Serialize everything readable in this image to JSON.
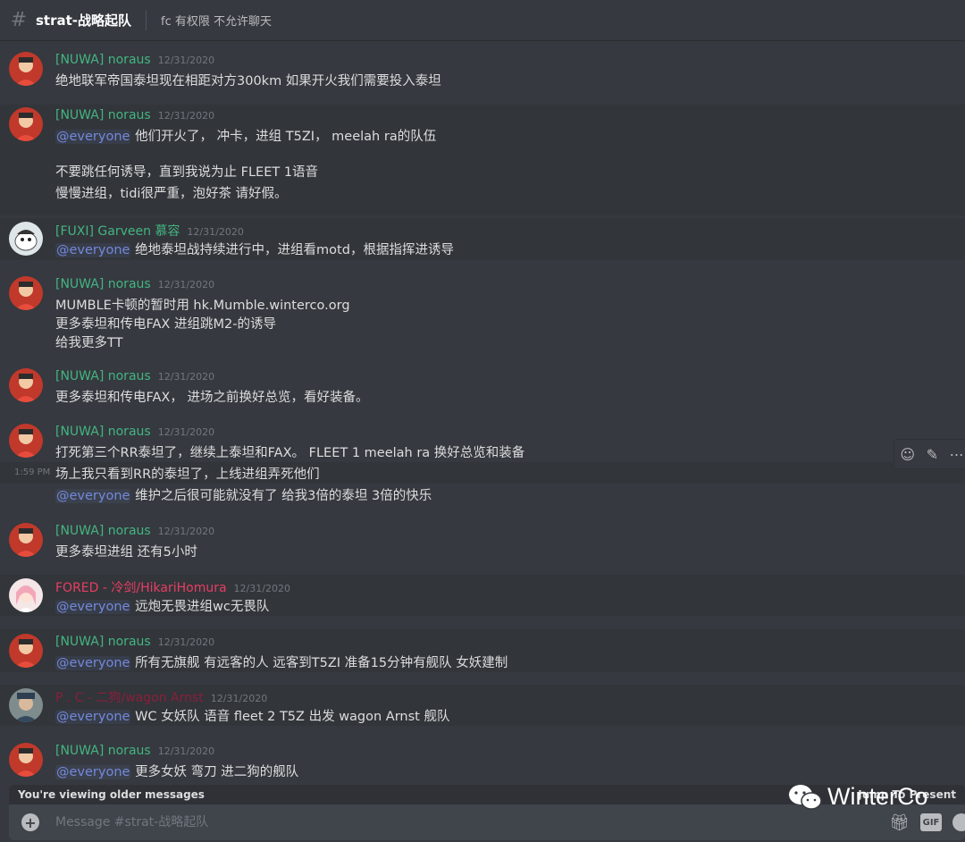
{
  "header": {
    "channel": "strat-战略起队",
    "topic": "fc 有权限 不允许聊天"
  },
  "messages": [
    {
      "author": "[NUWA] noraus",
      "time": "12/31/2020",
      "lines": [
        "绝地联军帝国泰坦现在相距对方300km 如果开火我们需要投入泰坦"
      ]
    },
    {
      "author": "[NUWA] noraus",
      "time": "12/31/2020",
      "mention": "@everyone",
      "lines": [
        "他们开火了， 冲卡，进组 T5ZI， meelah ra的队伍",
        "不要跳任何诱导，直到我说为止 FLEET 1语音",
        "慢慢进组，tidi很严重，泡好茶 请好假。"
      ]
    },
    {
      "author": "[FUXI] Garveen 慕容",
      "time": "12/31/2020",
      "mention": "@everyone",
      "lines": [
        "绝地泰坦战持续进行中，进组看motd，根据指挥进诱导"
      ]
    },
    {
      "author": "[NUWA] noraus",
      "time": "12/31/2020",
      "lines": [
        "MUMBLE卡顿的暂时用 hk.Mumble.winterco.org",
        "更多泰坦和传电FAX 进组跳M2-的诱导",
        "给我更多TT"
      ]
    },
    {
      "author": "[NUWA] noraus",
      "time": "12/31/2020",
      "lines": [
        "更多泰坦和传电FAX， 进场之前换好总览，看好装备。"
      ]
    },
    {
      "author": "[NUWA] noraus",
      "time": "12/31/2020",
      "hover_time": "1:59 PM",
      "mention": "@everyone",
      "lines": [
        "打死第三个RR泰坦了，继续上泰坦和FAX。 FLEET 1 meelah ra  换好总览和装备",
        "场上我只看到RR的泰坦了，上线进组弄死他们",
        "维护之后很可能就没有了 给我3倍的泰坦 3倍的快乐"
      ]
    },
    {
      "author": "[NUWA] noraus",
      "time": "12/31/2020",
      "lines": [
        "更多泰坦进组 还有5小时"
      ]
    },
    {
      "author": "FORED - 冷剑/HikariHomura",
      "time": "12/31/2020",
      "mention": "@everyone",
      "lines": [
        "远炮无畏进组wc无畏队"
      ]
    },
    {
      "author": "[NUWA] noraus",
      "time": "12/31/2020",
      "mention": "@everyone",
      "lines": [
        "所有无旗舰 有远客的人 远客到T5ZI 准备15分钟有舰队 女妖建制"
      ]
    },
    {
      "author": "P . C - 二狗/wagon Arnst",
      "time": "12/31/2020",
      "mention": "@everyone",
      "lines": [
        "WC 女妖队 语音 fleet 2 T5Z 出发 wagon Arnst 舰队"
      ]
    },
    {
      "author": "[NUWA] noraus",
      "time": "12/31/2020",
      "mention": "@everyone",
      "lines": [
        "更多女妖 弯刀 进二狗的舰队"
      ]
    }
  ],
  "bottom": {
    "older_messages": "You're viewing older messages",
    "jump": "Jump To Present",
    "placeholder": "Message #strat-战略起队",
    "gif": "GIF"
  },
  "watermark": "WinterCo",
  "colors": {
    "background": "#36393f",
    "author_green": "#43b581",
    "author_pink": "#e83e63",
    "mention": "#7289da"
  }
}
